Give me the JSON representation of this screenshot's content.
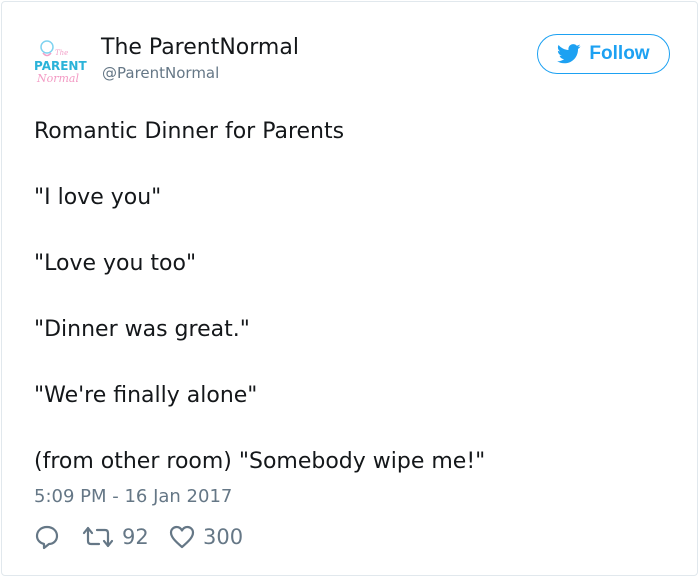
{
  "tweet": {
    "display_name": "The ParentNormal",
    "handle": "@ParentNormal",
    "avatar_text": [
      "PARENT",
      "Normal"
    ],
    "follow_label": "Follow",
    "lines": [
      "Romantic Dinner for Parents",
      "\"I love you\"",
      "\"Love you too\"",
      "\"Dinner was great.\"",
      "\"We're finally alone\"",
      "(from other room) \"Somebody wipe me!\""
    ],
    "timestamp": "5:09 PM - 16 Jan 2017",
    "retweet_count": "92",
    "like_count": "300"
  },
  "icons": {
    "follow": "twitter-bird-icon",
    "reply": "reply-icon",
    "retweet": "retweet-icon",
    "like": "heart-icon"
  },
  "colors": {
    "accent": "#1da1f2",
    "text": "#14171a",
    "muted": "#657786",
    "border": "#e1e8ed"
  }
}
